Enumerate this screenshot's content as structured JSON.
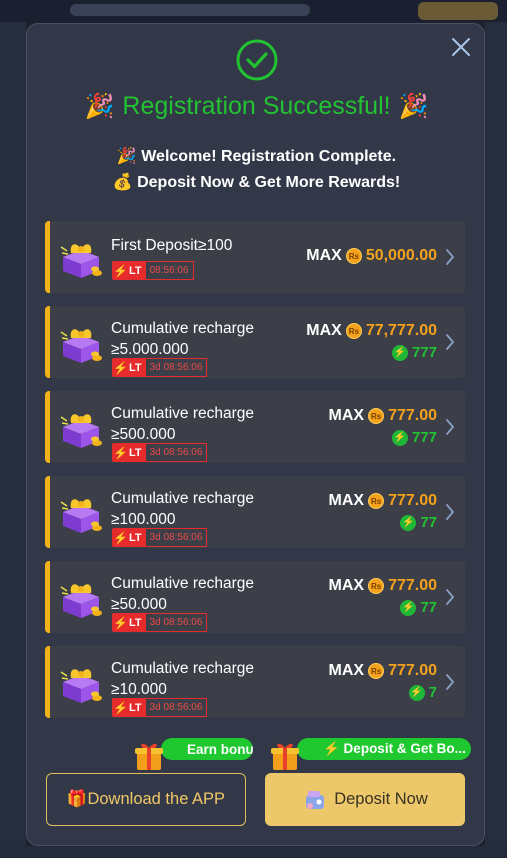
{
  "modal": {
    "title": "Registration Successful!",
    "welcome_text": "🎉 Welcome! Registration Complete.",
    "deposit_text": "💰 Deposit Now & Get More Rewards!"
  },
  "rewards": [
    {
      "title": "First Deposit≥100",
      "lt": "LT",
      "timer": "08:56:06",
      "max_label": "MAX",
      "currency": "Rs",
      "amount": "50,000.00",
      "bonus": ""
    },
    {
      "title": "Cumulative recharge ≥5.000.000",
      "lt": "LT",
      "timer": "3d 08:56:06",
      "max_label": "MAX",
      "currency": "Rs",
      "amount": "77,777.00",
      "bonus": "777"
    },
    {
      "title": "Cumulative recharge ≥500.000",
      "lt": "LT",
      "timer": "3d 08:56:06",
      "max_label": "MAX",
      "currency": "Rs",
      "amount": "777.00",
      "bonus": "777"
    },
    {
      "title": "Cumulative recharge ≥100.000",
      "lt": "LT",
      "timer": "3d 08:56:06",
      "max_label": "MAX",
      "currency": "Rs",
      "amount": "777.00",
      "bonus": "77"
    },
    {
      "title": "Cumulative recharge ≥50.000",
      "lt": "LT",
      "timer": "3d 08:56:06",
      "max_label": "MAX",
      "currency": "Rs",
      "amount": "777.00",
      "bonus": "77"
    },
    {
      "title": "Cumulative recharge ≥10.000",
      "lt": "LT",
      "timer": "3d 08:56:06",
      "max_label": "MAX",
      "currency": "Rs",
      "amount": "777.00",
      "bonus": "7"
    }
  ],
  "footer": {
    "earn_bonus_tag": "Earn bonus",
    "deposit_tag": "⚡ Deposit & Get Bo...",
    "download_label": "🎁Download the APP",
    "deposit_label": "Deposit Now"
  },
  "icons": {
    "close": "close-icon",
    "success": "check-circle-icon",
    "gift": "gift-box-icon",
    "bolt": "bolt-icon",
    "chevron": "chevron-right-icon"
  },
  "colors": {
    "success_green": "#22c232",
    "accent_gold": "#f2b21a",
    "amount_orange": "#f4a21c",
    "timer_red": "#e52b2b",
    "deposit_button": "#ecc86a"
  }
}
